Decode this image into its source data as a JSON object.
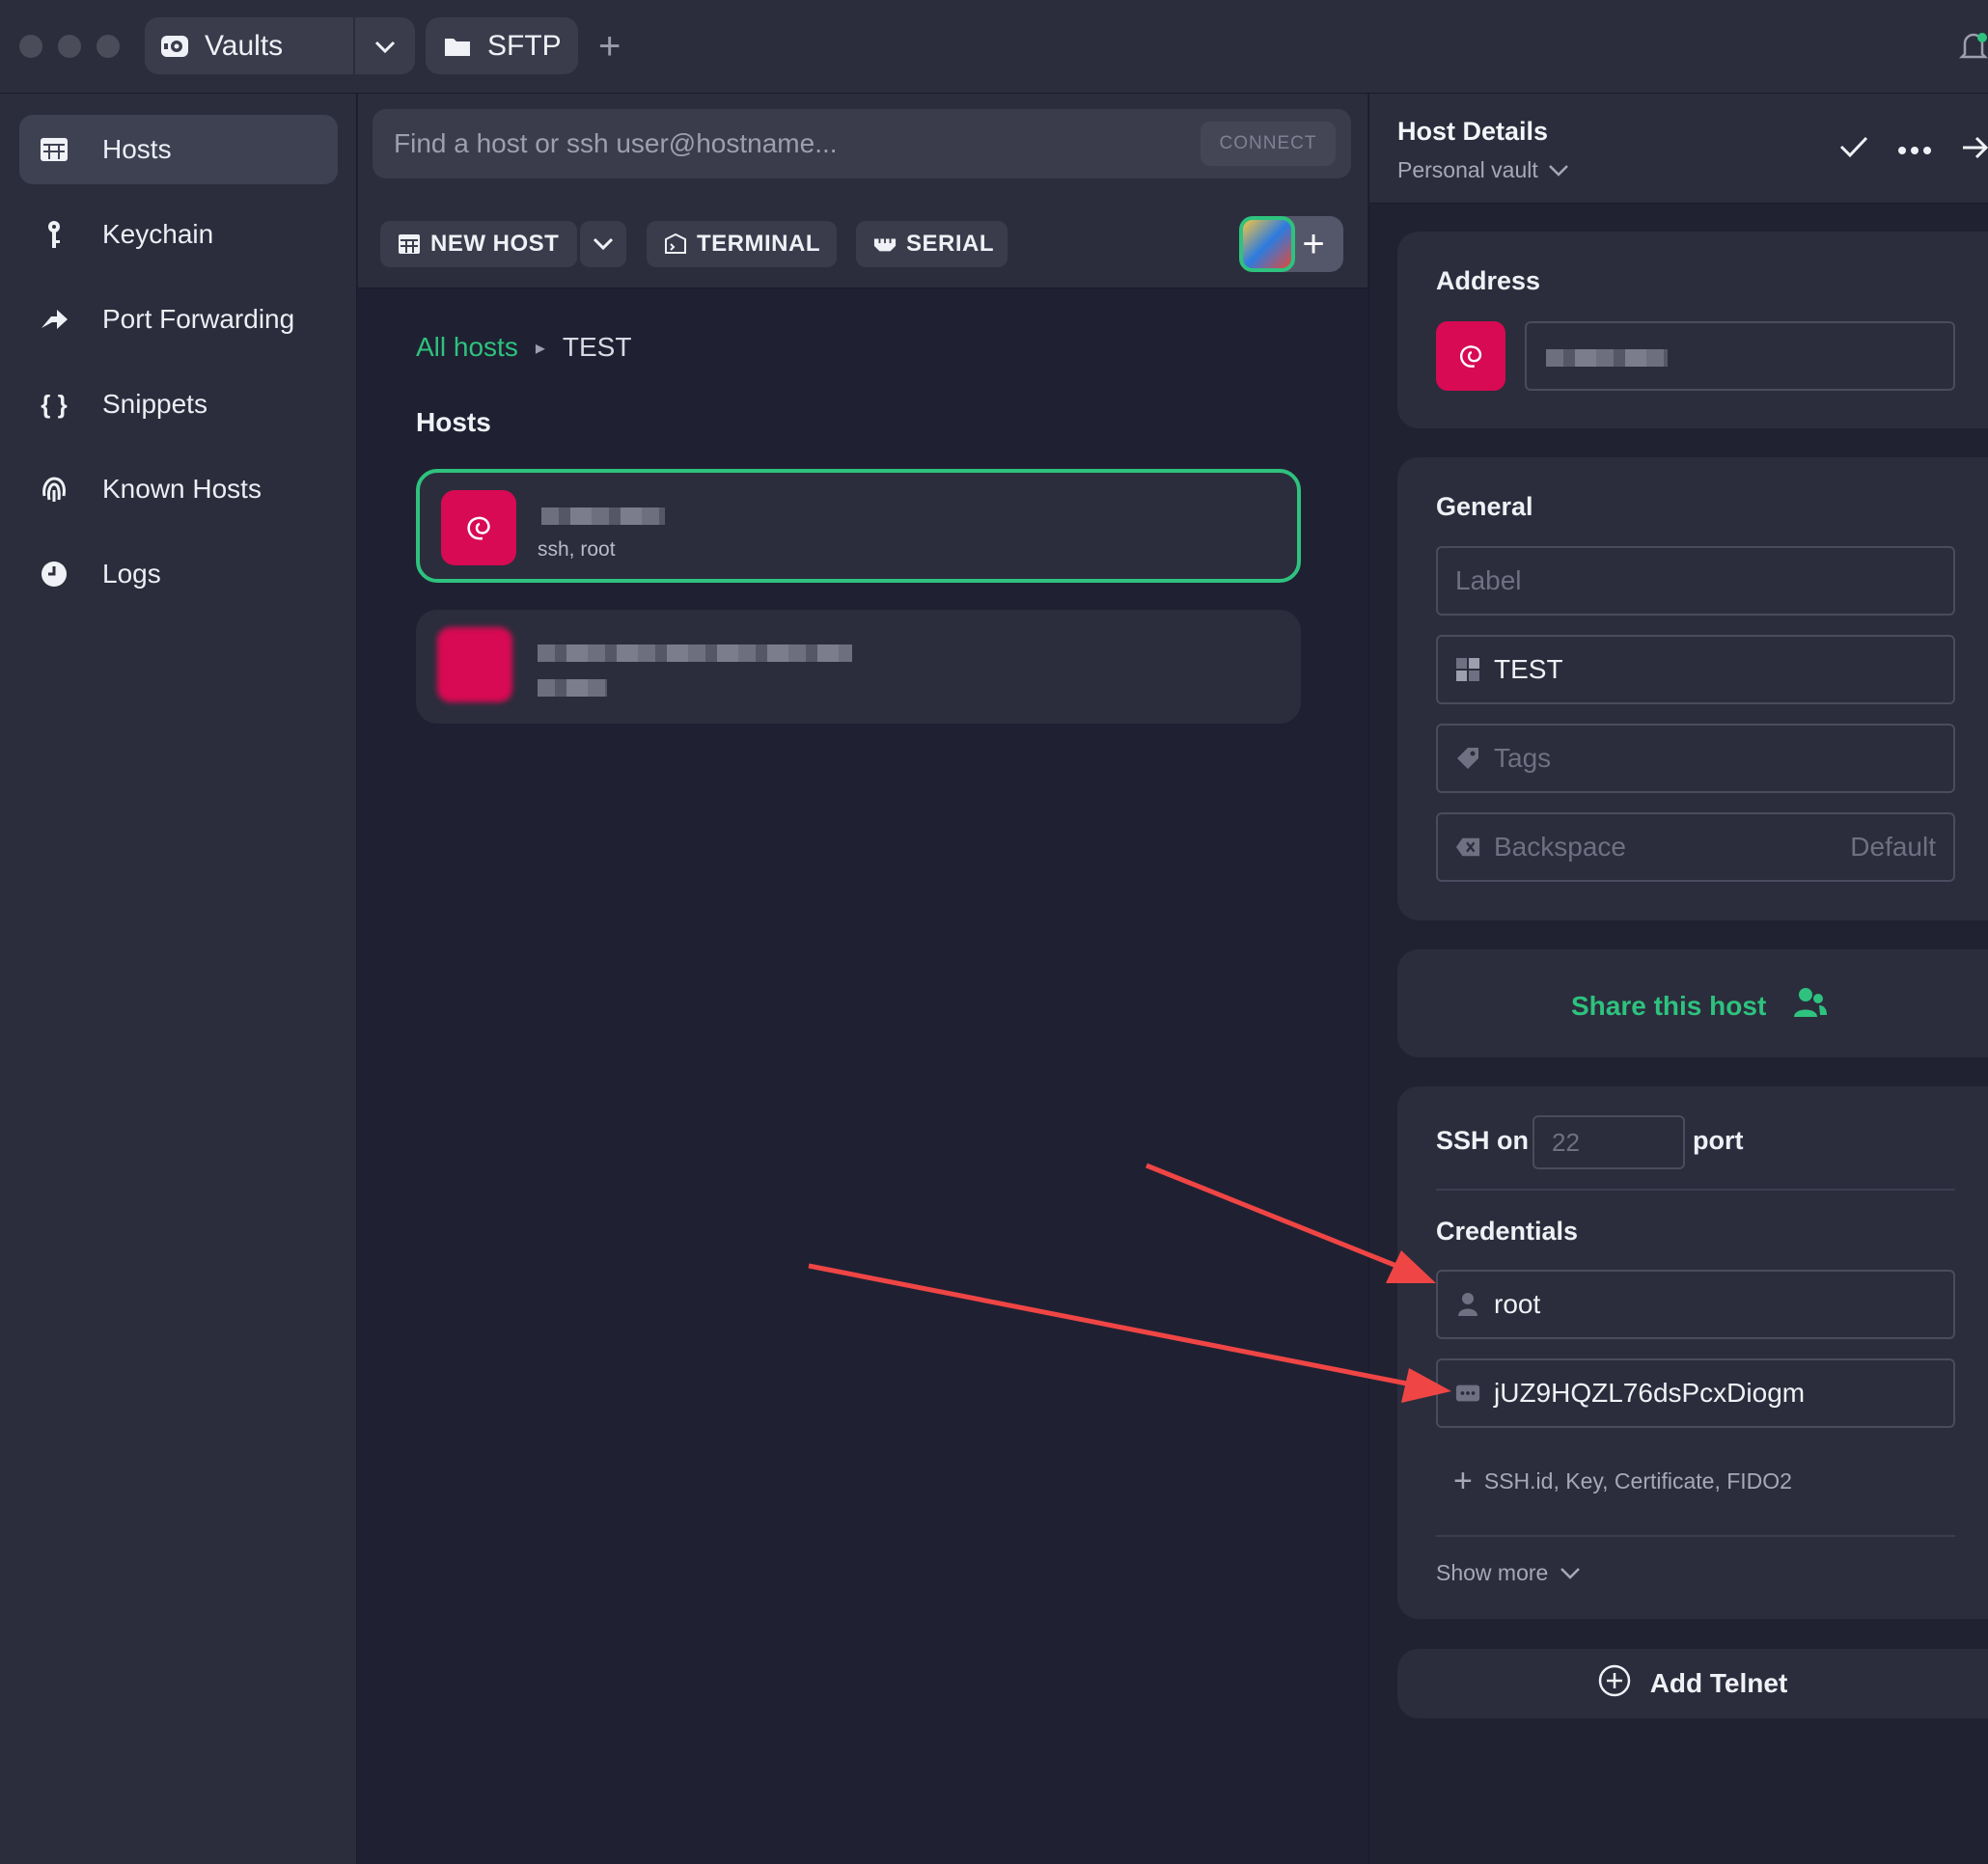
{
  "titlebar": {
    "tabs": [
      {
        "label": "Vaults",
        "icon": "vault-icon"
      },
      {
        "label": "SFTP",
        "icon": "folder-icon"
      }
    ]
  },
  "sidebar": {
    "items": [
      {
        "label": "Hosts",
        "icon": "hosts-grid-icon",
        "active": true
      },
      {
        "label": "Keychain",
        "icon": "key-icon"
      },
      {
        "label": "Port Forwarding",
        "icon": "forward-arrow-icon"
      },
      {
        "label": "Snippets",
        "icon": "braces-icon"
      },
      {
        "label": "Known Hosts",
        "icon": "fingerprint-icon"
      },
      {
        "label": "Logs",
        "icon": "clock-icon"
      }
    ]
  },
  "search": {
    "placeholder": "Find a host or ssh user@hostname...",
    "connect_label": "CONNECT"
  },
  "toolbar": {
    "new_host": "NEW HOST",
    "terminal": "TERMINAL",
    "serial": "SERIAL"
  },
  "breadcrumb": {
    "root": "All hosts",
    "current": "TEST"
  },
  "hosts": {
    "heading": "Hosts",
    "items": [
      {
        "subtitle": "ssh, root",
        "selected": true
      },
      {
        "subtitle": "",
        "selected": false
      }
    ]
  },
  "details": {
    "title": "Host Details",
    "vault": "Personal vault",
    "address_label": "Address",
    "general_label": "General",
    "label_placeholder": "Label",
    "group_value": "TEST",
    "tags_placeholder": "Tags",
    "backspace_label": "Backspace",
    "backspace_value": "Default",
    "share_label": "Share this host",
    "ssh_on": "SSH on",
    "port_placeholder": "22",
    "port_word": "port",
    "credentials_label": "Credentials",
    "username": "root",
    "password": "jUZ9HQZL76dsPcxDiogm",
    "add_credentials": "SSH.id, Key, Certificate, FIDO2",
    "show_more": "Show more",
    "add_telnet": "Add Telnet"
  },
  "colors": {
    "accent_green": "#2ec27e",
    "debian_red": "#d70a53",
    "annotation_arrow": "#f04545"
  }
}
